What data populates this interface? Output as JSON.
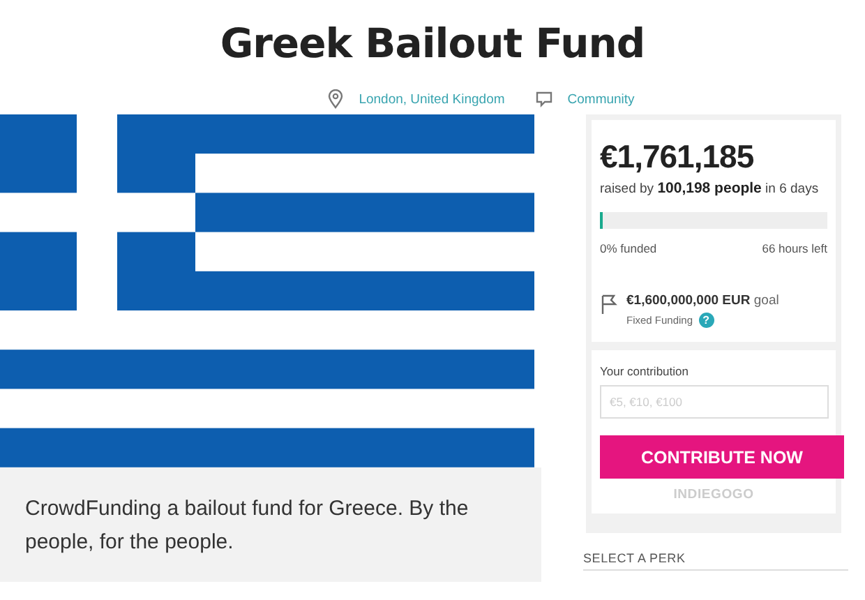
{
  "title": "Greek Bailout Fund",
  "meta": [
    {
      "kind": "location",
      "label": "London, United Kingdom"
    },
    {
      "kind": "category",
      "label": "Community"
    }
  ],
  "tagline": "CrowdFunding a bailout fund for Greece. By the people, for the people.",
  "campaign": {
    "amount": "€1,761,185",
    "raised": "raised by **100,198 people** in 6 days",
    "progress": {
      "level": 0.01
    },
    "funded": "0% funded",
    "time_left": "66 hours left",
    "goal": "**€1,600,000,000 EUR** goal",
    "funding_type": "Fixed Funding",
    "help": "?"
  },
  "contribution": {
    "label": "Your contribution",
    "placeholder": "€5, €10, €100",
    "button": "CONTRIBUTE NOW",
    "brand": "INDIEGOGO"
  },
  "perk_heading": "SELECT A PERK"
}
